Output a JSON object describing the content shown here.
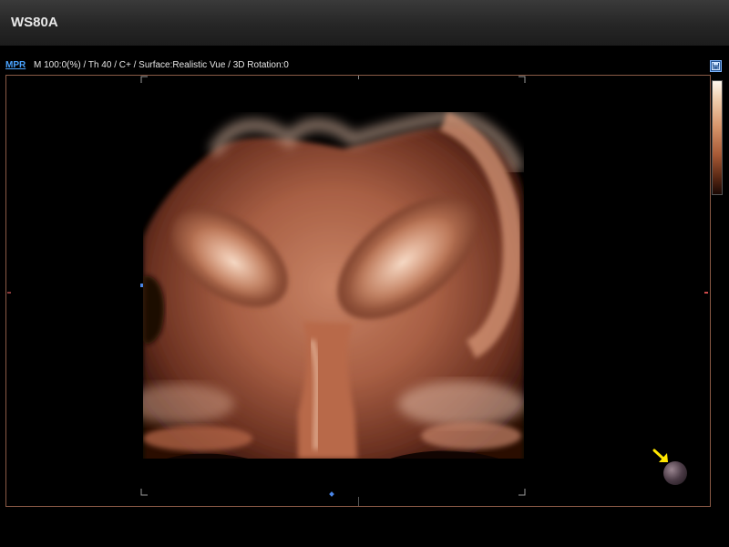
{
  "app": {
    "title": "WS80A"
  },
  "info": {
    "mode_link": "MPR",
    "params": "M 100:0(%) / Th 40 / C+ / Surface:Realistic Vue / 3D Rotation:0"
  },
  "colors": {
    "border": "#8a5a46",
    "accent_link": "#4aa3ff",
    "marker_blue": "#4a86e8",
    "marker_red": "#cc4a4a",
    "arrow_yellow": "#ffe600"
  },
  "icons": {
    "save": "save-icon",
    "orientation": "orientation-ball-icon",
    "arrow": "yellow-arrow-icon"
  }
}
